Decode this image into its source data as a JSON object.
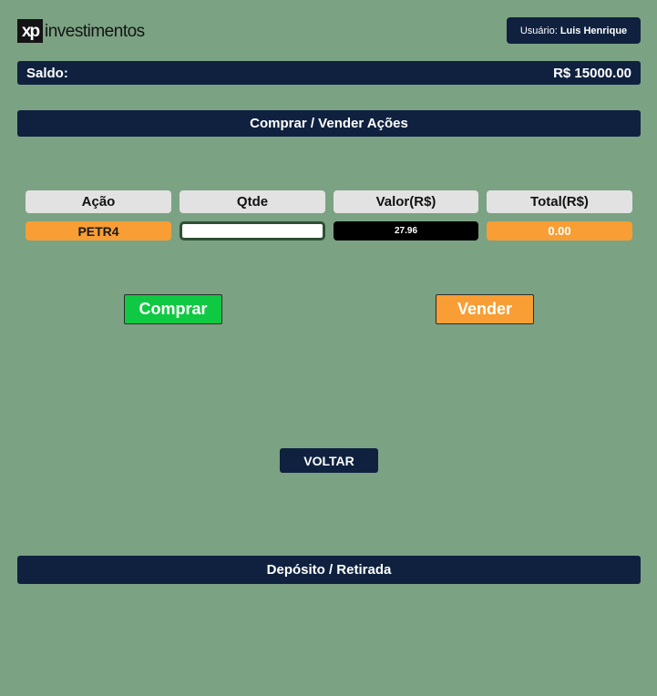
{
  "brand": {
    "mark": "xp",
    "text": "investimentos"
  },
  "user": {
    "label": "Usuário:",
    "name": "Luis Henrique"
  },
  "balance": {
    "label": "Saldo:",
    "value": "R$ 15000.00"
  },
  "trade_section": {
    "title": "Comprar / Vender Ações"
  },
  "table": {
    "headers": [
      "Ação",
      "Qtde",
      "Valor(R$)",
      "Total(R$)"
    ],
    "row": {
      "ticker": "PETR4",
      "quantity": "",
      "price": "27.96",
      "total": "0.00"
    }
  },
  "actions": {
    "buy_label": "Comprar",
    "sell_label": "Vender",
    "back_label": "VOLTAR"
  },
  "deposit_section": {
    "title": "Depósito / Retirada"
  },
  "colors": {
    "page_background": "#7ba283",
    "navy": "#0f213f",
    "buy_green": "#10c942",
    "sell_orange": "#f89e35"
  }
}
